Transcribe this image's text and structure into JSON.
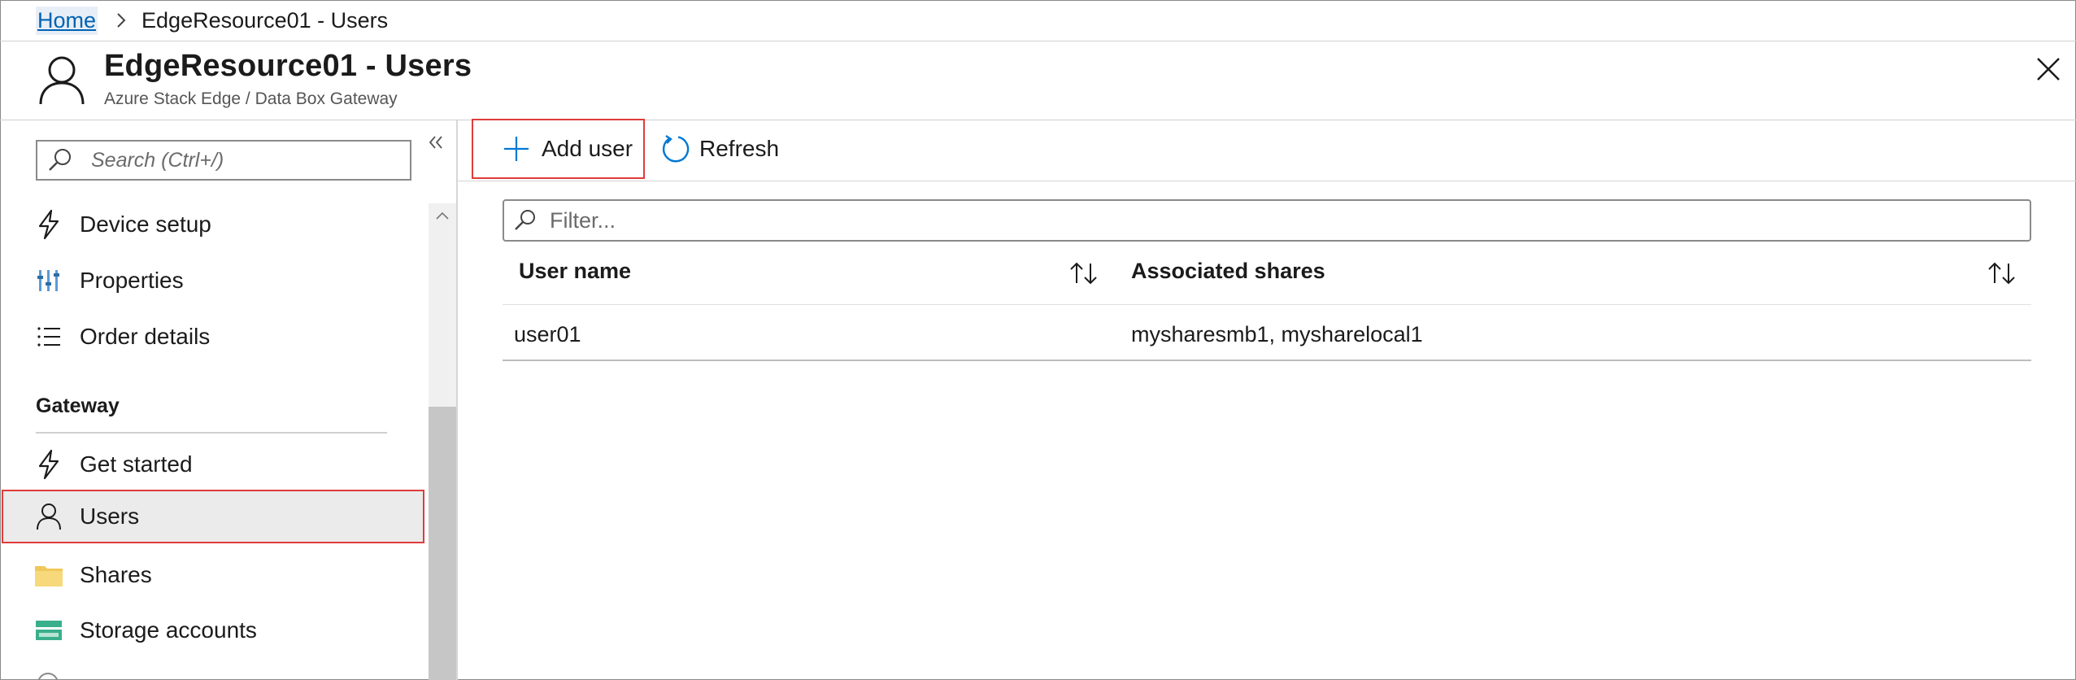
{
  "breadcrumb": {
    "home": "Home",
    "current": "EdgeResource01 - Users"
  },
  "header": {
    "title": "EdgeResource01 - Users",
    "subtitle": "Azure Stack Edge / Data Box Gateway"
  },
  "sidebar": {
    "search_placeholder": "Search (Ctrl+/)",
    "items_top": [
      {
        "label": "Device setup",
        "icon": "lightning-icon"
      },
      {
        "label": "Properties",
        "icon": "properties-icon"
      },
      {
        "label": "Order details",
        "icon": "list-icon"
      }
    ],
    "section": "Gateway",
    "items_gateway": [
      {
        "label": "Get started",
        "icon": "lightning-icon"
      },
      {
        "label": "Users",
        "icon": "user-icon",
        "selected": true
      },
      {
        "label": "Shares",
        "icon": "folder-icon"
      },
      {
        "label": "Storage accounts",
        "icon": "storage-icon"
      }
    ]
  },
  "toolbar": {
    "add_user": "Add user",
    "refresh": "Refresh"
  },
  "filter": {
    "placeholder": "Filter..."
  },
  "table": {
    "columns": [
      "User name",
      "Associated shares"
    ],
    "rows": [
      {
        "user": "user01",
        "shares": "mysharesmb1, mysharelocal1"
      }
    ]
  },
  "colors": {
    "accent": "#0078d4",
    "highlight_border": "#e03c3c",
    "selected_bg": "#ebebeb"
  }
}
